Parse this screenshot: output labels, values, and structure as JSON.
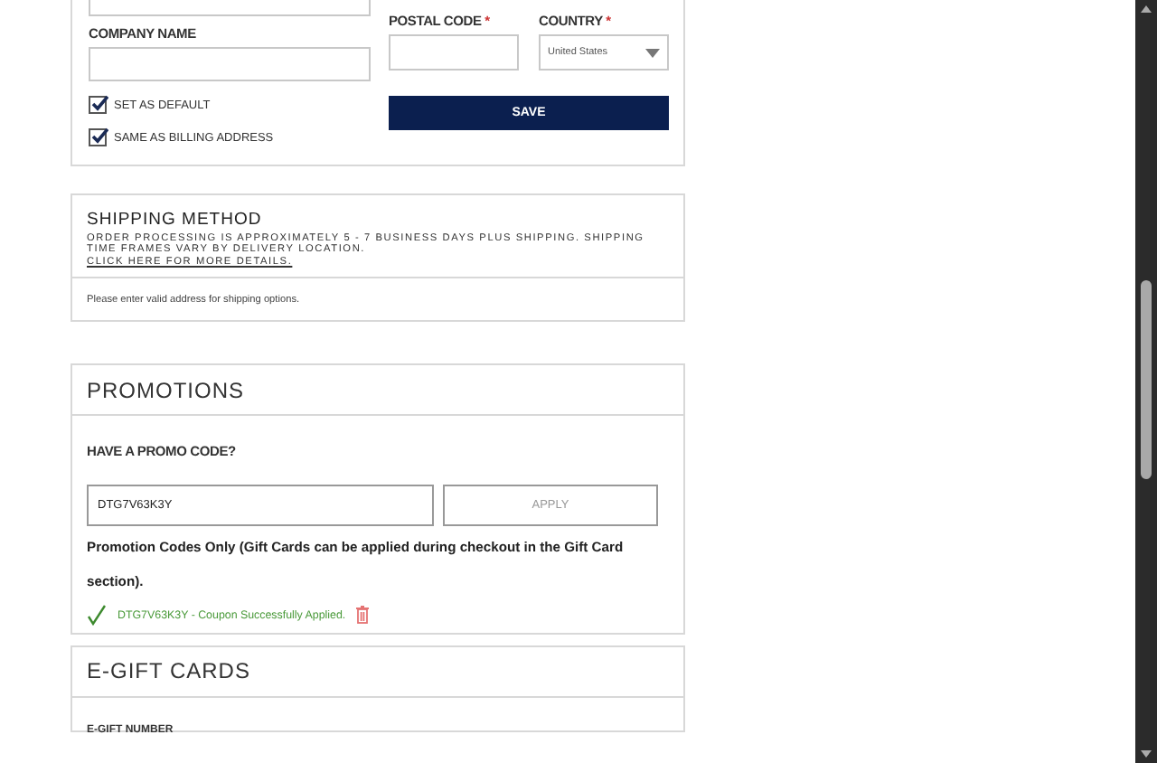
{
  "address_form": {
    "postal_code_label": "POSTAL CODE",
    "country_label": "COUNTRY",
    "required_mark": "*",
    "company_name_label": "COMPANY NAME",
    "country_value": "United States",
    "save_button": "SAVE",
    "checkboxes": [
      {
        "label": "SET AS DEFAULT",
        "checked": true
      },
      {
        "label": "SAME AS BILLING ADDRESS",
        "checked": true
      }
    ]
  },
  "shipping_method": {
    "title": "SHIPPING METHOD",
    "note": "ORDER PROCESSING IS APPROXIMATELY 5 - 7 BUSINESS DAYS PLUS SHIPPING. SHIPPING TIME FRAMES VARY BY DELIVERY LOCATION.",
    "link": "CLICK HERE FOR MORE DETAILS.",
    "message": "Please enter valid address for shipping options."
  },
  "promotions": {
    "title": "PROMOTIONS",
    "label": "HAVE A PROMO CODE?",
    "code_value": "DTG7V63K3Y",
    "apply_button": "APPLY",
    "info": "Promotion Codes Only (Gift Cards can be applied during checkout in the Gift Card section).",
    "success": "DTG7V63K3Y - Coupon Successfully Applied."
  },
  "egift_cards": {
    "title": "E-GIFT CARDS",
    "number_label": "E-GIFT NUMBER"
  }
}
